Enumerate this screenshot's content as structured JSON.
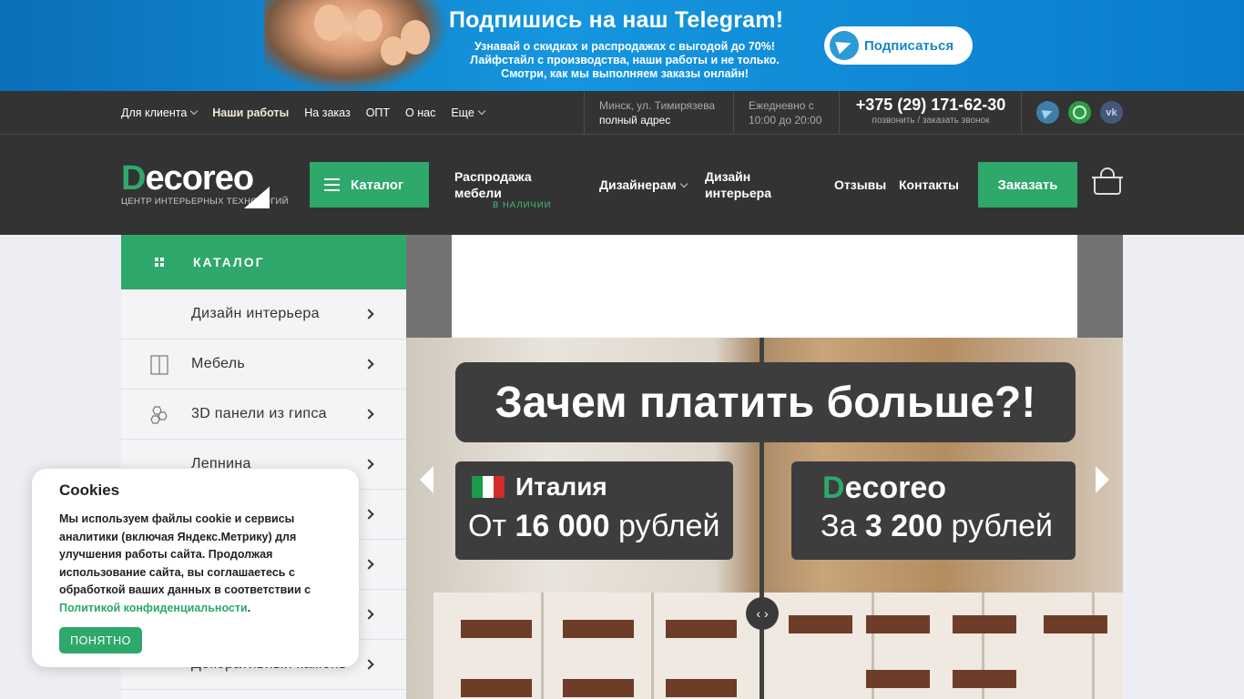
{
  "promo": {
    "title": "Подпишись на наш Telegram!",
    "line1_pre": "Узнавай о скидках и распродажах с выгодой",
    "line1_bold": "до 70%!",
    "line2": "Лайфстайл с производства, наши работы и не только.",
    "line3": "Смотри, как мы выполняем заказы онлайн!",
    "button_label": "Подписаться"
  },
  "topnav": {
    "items": [
      {
        "label": "Для клиента"
      },
      {
        "label": "Наши работы"
      },
      {
        "label": "На заказ"
      },
      {
        "label": "ОПТ"
      },
      {
        "label": "О нас"
      },
      {
        "label": "Еще"
      }
    ],
    "address_line1": "Минск, ул. Тимирязева",
    "address_line2": "полный адрес",
    "hours_line1": "Ежедневно с",
    "hours_line2": "10:00 до 20:00",
    "phone": "+375 (29) 171-62-30",
    "phone_note": "позвонить / заказать звонок",
    "social_vk": "vk"
  },
  "header": {
    "logo_text": "ecoreo",
    "logo_tagline": "ЦЕНТР ИНТЕРЬЕРНЫХ ТЕХНОЛОГИЙ",
    "catalog_button": "Каталог",
    "nav": {
      "sale_line1": "Распродажа",
      "sale_line2": "мебели",
      "sale_note": "В НАЛИЧИИ",
      "designers": "Дизайнерам",
      "interior_line1": "Дизайн",
      "interior_line2": "интерьера",
      "reviews": "Отзывы",
      "contacts": "Контакты"
    },
    "order_button": "Заказать"
  },
  "sidebar": {
    "title": "КАТАЛОГ",
    "items": [
      {
        "label": "Дизайн интерьера"
      },
      {
        "label": "Мебель"
      },
      {
        "label": "3D панели из гипса"
      },
      {
        "label": "Лепнина"
      },
      {
        "label": ""
      },
      {
        "label": ""
      },
      {
        "label": ""
      },
      {
        "label": "Декоративный камень"
      }
    ]
  },
  "slide": {
    "headline": "Зачем платить больше?!",
    "left_title": "Италия",
    "left_prefix": "От",
    "left_price": "16 000",
    "left_currency": "рублей",
    "right_logo": "ecoreo",
    "right_prefix": "За",
    "right_price": "3 200",
    "right_currency": "рублей"
  },
  "cookie": {
    "title": "Cookies",
    "text": "Мы используем файлы cookie и сервисы аналитики (включая Яндекс.Метрику) для улучшения работы сайта. Продолжая использование сайта, вы соглашаетесь с обработкой ваших данных в соответствии с ",
    "link": "Политикой конфиденциальности",
    "text_end": ".",
    "button": "ПОНЯТНО"
  },
  "colors": {
    "accent": "#2ea86b",
    "header_bg": "#333333",
    "telegram": "#2d9ad8"
  },
  "icons": [
    "telegram-icon",
    "whatsapp-icon",
    "vk-icon",
    "basket-icon",
    "list-icon",
    "grid-icon",
    "chevron-right-icon",
    "compare-icon"
  ]
}
